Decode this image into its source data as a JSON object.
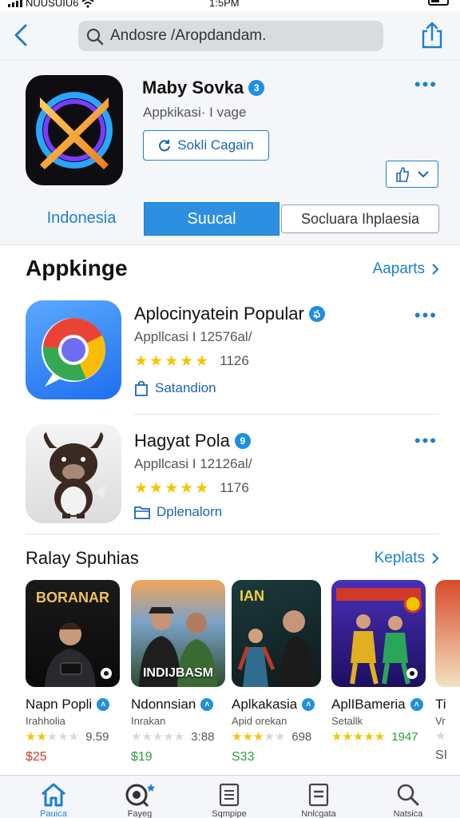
{
  "status_bar": {
    "carrier": "NUUSUIU6",
    "time": "1:5PM"
  },
  "search": {
    "placeholder": "Andosre /Aropdandam."
  },
  "featured": {
    "name": "Maby Sovka",
    "verified_mark": "3",
    "subtitle": "Appkikasi· I vage",
    "get_label": "Sokli Cagain",
    "segments": [
      "Indonesia",
      "Suucal",
      "Socluara Ihplaesia"
    ],
    "active_segment": "Suucal"
  },
  "section1": {
    "title": "Appkinge",
    "link": "Aaparts"
  },
  "list": [
    {
      "name": "Aplocinyatein Popular",
      "verified_mark": "ఫ",
      "subtitle": "Appllcasi I 12576al/",
      "stars": 5,
      "rating_count": "1126",
      "tag": "Satandion",
      "tag_icon": "bag-icon"
    },
    {
      "name": "Hagyat Pola",
      "verified_mark": "9",
      "subtitle": "Appllcasi I 12126al/",
      "stars": 5,
      "rating_count": "1176",
      "tag": "Dplenalorn",
      "tag_icon": "folder-icon"
    }
  ],
  "section2": {
    "title": "Ralay Spuhias",
    "link": "Keplats"
  },
  "cards": [
    {
      "title": "Napn Popli",
      "subtitle": "Irahholia",
      "stars": 2,
      "rating_count": "9.59",
      "price": "$25",
      "price_color": "#d13a2a",
      "poster_text": "BORANAR"
    },
    {
      "title": "Ndonnsian",
      "subtitle": "Inrakan",
      "stars": 0,
      "rating_count": "3:88",
      "price": "$19",
      "price_color": "#2f9a3e",
      "poster_text": "INDIJBASM"
    },
    {
      "title": "Aplkakasia",
      "subtitle": "Apid orekan",
      "stars": 3,
      "rating_count": "698",
      "price": "S33",
      "price_color": "#2f9a3e",
      "poster_text": "IAN"
    },
    {
      "title": "AplIBameria",
      "subtitle": "Setallk",
      "stars": 5,
      "rating_count": "1947",
      "price": "",
      "price_color": "#2f9a3e",
      "poster_text": ""
    },
    {
      "title": "Ti",
      "subtitle": "Vr",
      "stars": 0,
      "rating_count": "",
      "price": "SI",
      "price_color": "#555555",
      "poster_text": ""
    }
  ],
  "tabbar": [
    {
      "label": "Pauica",
      "icon": "home-icon",
      "active": true
    },
    {
      "label": "Fayeg",
      "icon": "search-badge-icon",
      "active": false
    },
    {
      "label": "Sqmpipe",
      "icon": "list-icon",
      "active": false
    },
    {
      "label": "Nnlcgata",
      "icon": "document-icon",
      "active": false
    },
    {
      "label": "Natsica",
      "icon": "magnifier-icon",
      "active": false
    }
  ],
  "colors": {
    "accent": "#1b7fd1",
    "star": "#f5c400",
    "segment_active": "#2d8fe0"
  }
}
